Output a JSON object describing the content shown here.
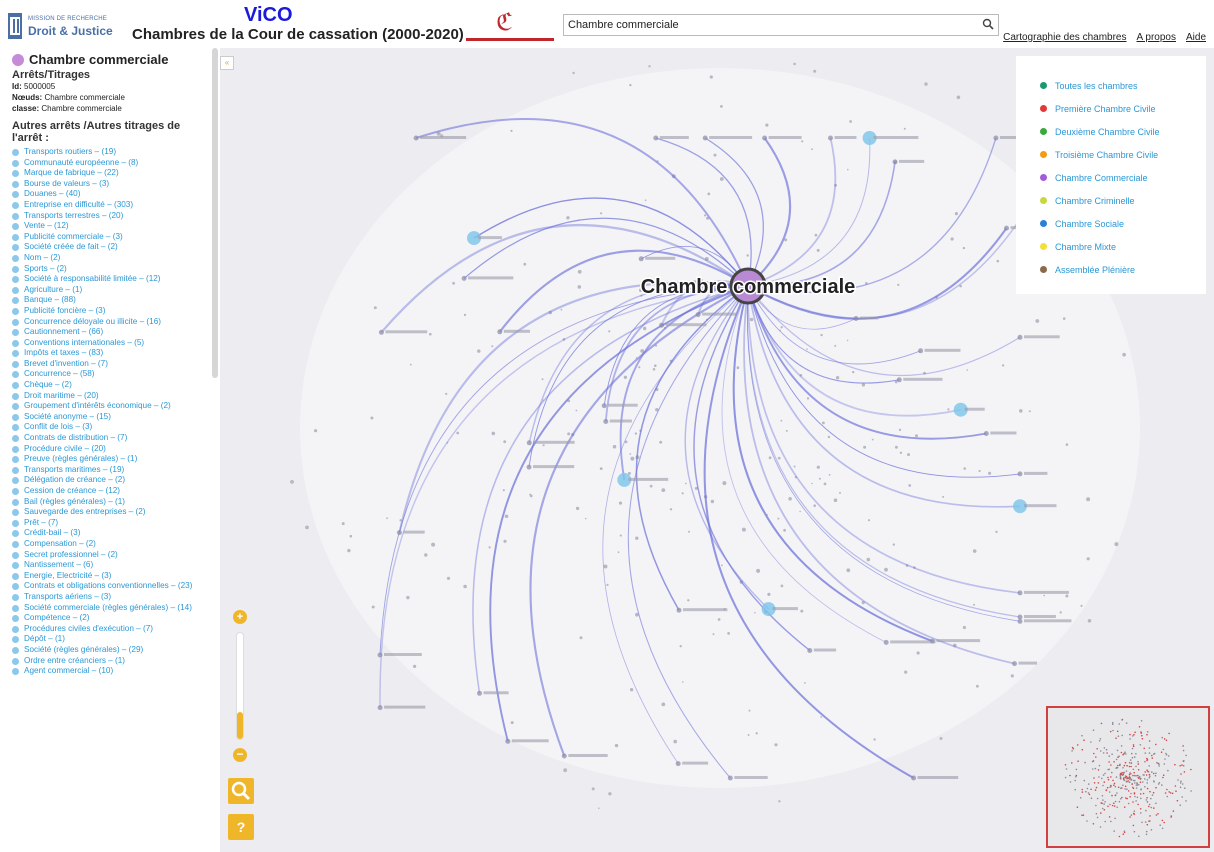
{
  "header": {
    "logo_mission_line1": "MISSION DE RECHERCHE",
    "logo_mission_line2": "Droit & Justice",
    "app_name": "ViCO",
    "app_subtitle": "Chambres de la Cour de cassation (2000-2020)",
    "search_value": "Chambre commerciale",
    "links": [
      "Cartographie des chambres",
      "A propos",
      "Aide"
    ]
  },
  "sidebar": {
    "node_title": "Chambre commerciale",
    "node_color": "#c58bd8",
    "section_title": "Arrêts/Titrages",
    "id_label": "Id:",
    "id_value": "5000005",
    "noeuds_label": "Nœuds:",
    "noeuds_value": "Chambre commerciale",
    "classe_label": "classe:",
    "classe_value": "Chambre commerciale",
    "other_heading": "Autres arrêts /Autres titrages de l'arrêt :",
    "topics": [
      "Transports routiers – (19)",
      "Communauté européenne – (8)",
      "Marque de fabrique – (22)",
      "Bourse de valeurs – (3)",
      "Douanes – (40)",
      "Entreprise en difficulté – (303)",
      "Transports terrestres – (20)",
      "Vente – (12)",
      "Publicité commerciale – (3)",
      "Société créée de fait – (2)",
      "Nom – (2)",
      "Sports – (2)",
      "Société à responsabilité limitée – (12)",
      "Agriculture – (1)",
      "Banque – (88)",
      "Publicité foncière – (3)",
      "Concurrence déloyale ou illicite – (16)",
      "Cautionnement – (66)",
      "Conventions internationales – (5)",
      "Impôts et taxes – (83)",
      "Brevet d'invention – (7)",
      "Concurrence – (58)",
      "Chèque – (2)",
      "Droit maritime – (20)",
      "Groupement d'intérêts économique – (2)",
      "Société anonyme – (15)",
      "Conflit de lois – (3)",
      "Contrats de distribution – (7)",
      "Procédure civile – (20)",
      "Preuve (règles générales) – (1)",
      "Transports maritimes – (19)",
      "Délégation de créance – (2)",
      "Cession de créance – (12)",
      "Bail (règles générales) – (1)",
      "Sauvegarde des entreprises – (2)",
      "Prêt – (7)",
      "Crédit-bail – (3)",
      "Compensation – (2)",
      "Secret professionnel – (2)",
      "Nantissement – (6)",
      "Energie, Electricité – (3)",
      "Contrats et obligations conventionnelles – (23)",
      "Transports aériens – (3)",
      "Société commerciale (règles générales) – (14)",
      "Compétence – (2)",
      "Procédures civiles d'exécution – (7)",
      "Dépôt – (1)",
      "Société (règles générales) – (29)",
      "Ordre entre créanciers – (1)",
      "Agent commercial – (10)"
    ]
  },
  "graph": {
    "center_label": "Chambre commerciale",
    "center_color": "#b98ad4",
    "edge_color": "#6a6fd8",
    "node_color": "#7cc4ea"
  },
  "legend": {
    "items": [
      {
        "label": "Toutes les chambres",
        "color": "#1a9a6c"
      },
      {
        "label": "Première Chambre Civile",
        "color": "#e53935"
      },
      {
        "label": "Deuxième Chambre Civile",
        "color": "#3aa83a"
      },
      {
        "label": "Troisième Chambre Civile",
        "color": "#f39c12"
      },
      {
        "label": "Chambre Commerciale",
        "color": "#a35bd6"
      },
      {
        "label": "Chambre Criminelle",
        "color": "#c8d83a"
      },
      {
        "label": "Chambre Sociale",
        "color": "#2a7fd6"
      },
      {
        "label": "Chambre Mixte",
        "color": "#f2e035"
      },
      {
        "label": "Assemblée Plénière",
        "color": "#8a6a4a"
      }
    ]
  },
  "controls": {
    "zoom_level": 0.25,
    "zoom_in_symbol": "+",
    "zoom_out_symbol": "−",
    "help_symbol": "?",
    "collapse_symbol": "«"
  }
}
